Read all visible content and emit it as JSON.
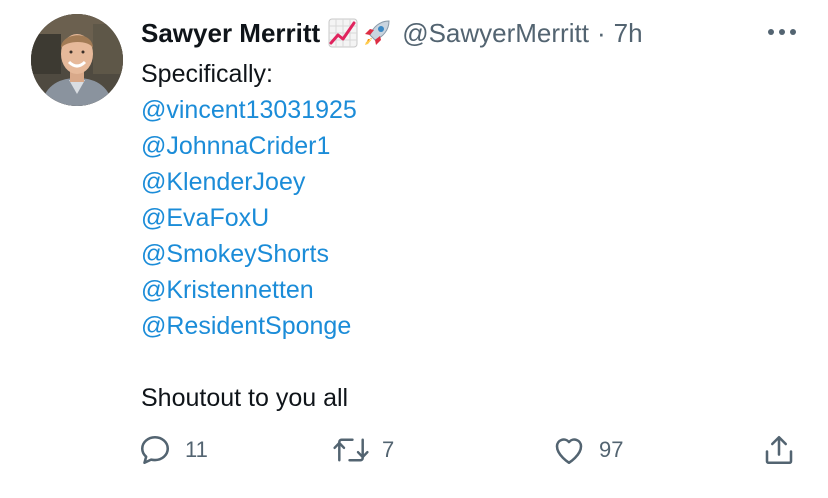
{
  "tweet": {
    "author_name": "Sawyer Merritt",
    "author_emojis": [
      "chart-increasing-icon",
      "rocket-icon"
    ],
    "handle": "@SawyerMerritt",
    "separator": "·",
    "time": "7h",
    "intro": "Specifically:",
    "mentions": [
      "@vincent13031925",
      "@JohnnaCrider1",
      "@KlenderJoey",
      "@EvaFoxU",
      "@SmokeyShorts",
      "@Kristennetten",
      "@ResidentSponge"
    ],
    "closing": "Shoutout to you all"
  },
  "actions": {
    "reply_count": "11",
    "retweet_count": "7",
    "like_count": "97"
  },
  "colors": {
    "text": "#0f1419",
    "secondary": "#536471",
    "link": "#1b8cd8"
  }
}
